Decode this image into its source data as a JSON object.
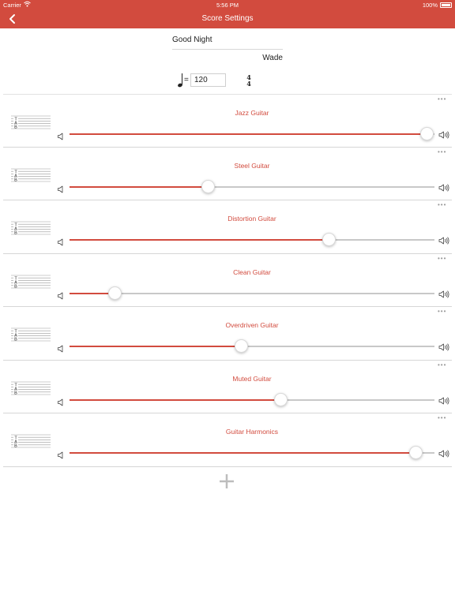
{
  "status_bar": {
    "carrier": "Carrier",
    "wifi_icon": "wifi-icon",
    "time": "5:56 PM",
    "battery": "100%"
  },
  "nav": {
    "title": "Score Settings",
    "back_icon": "chevron-left-icon",
    "color": "#d24b3e"
  },
  "score": {
    "title_value": "Good Night",
    "author_value": "Wade",
    "tempo_value": "120",
    "time_signature": {
      "numerator": "4",
      "denominator": "4"
    }
  },
  "tracks": [
    {
      "name": "Jazz Guitar",
      "volume": 0.98
    },
    {
      "name": "Steel Guitar",
      "volume": 0.38
    },
    {
      "name": "Distortion Guitar",
      "volume": 0.71
    },
    {
      "name": "Clean Guitar",
      "volume": 0.125
    },
    {
      "name": "Overdriven Guitar",
      "volume": 0.47
    },
    {
      "name": "Muted Guitar",
      "volume": 0.58
    },
    {
      "name": "Guitar Harmonics",
      "volume": 0.95
    }
  ],
  "icons": {
    "more": "more-icon",
    "tab_staff": "tab-staff-icon",
    "volume_min": "speaker-low-icon",
    "volume_max": "speaker-high-icon",
    "add": "plus-icon"
  },
  "tab_letters": [
    "T",
    "A",
    "B"
  ],
  "more_glyph": "•••"
}
